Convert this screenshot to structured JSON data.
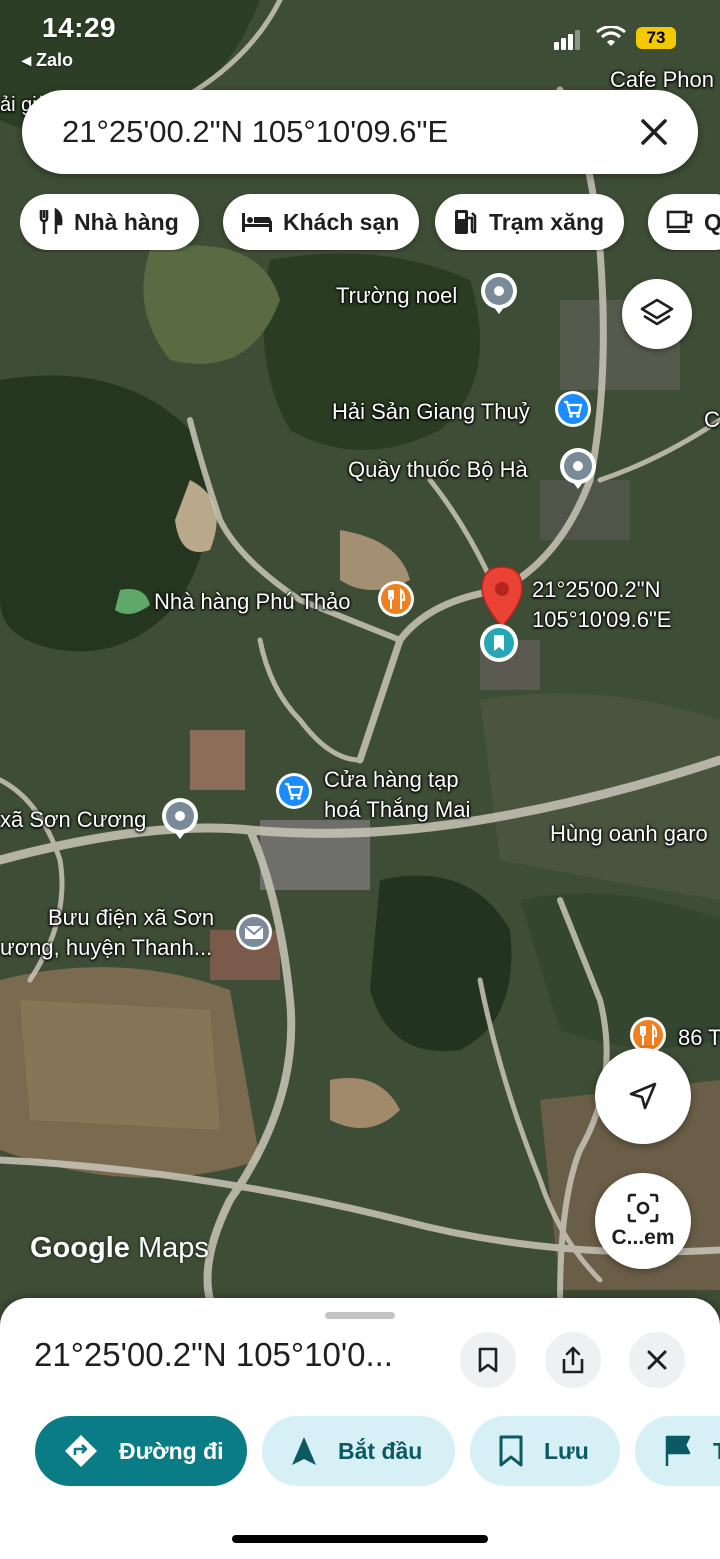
{
  "status_bar": {
    "time": "14:29",
    "back_app": "Zalo",
    "battery": "73"
  },
  "search": {
    "query": "21°25'00.2\"N 105°10'09.6\"E"
  },
  "chips": [
    {
      "label": "Nhà hàng",
      "icon": "restaurant-icon"
    },
    {
      "label": "Khách sạn",
      "icon": "hotel-icon"
    },
    {
      "label": "Trạm xăng",
      "icon": "gas-station-icon"
    },
    {
      "label": "Q",
      "icon": "coffee-icon"
    }
  ],
  "map": {
    "labels": {
      "cafe": "Cafe Phon",
      "top_left": "ải già",
      "truong_noel": "Trường noel",
      "hai_san": "Hải Sản Giang Thuỷ",
      "quay_thuoc": "Quầy thuốc Bộ Hà",
      "coord_line1": "21°25'00.2\"N",
      "coord_line2": "105°10'09.6\"E",
      "nha_hang": "Nhà hàng Phú Thảo",
      "cua_hang_line1": "Cửa hàng tạp",
      "cua_hang_line2": "hoá Thắng Mai",
      "xa_son_cuong": "xã Sơn Cương",
      "hung_oanh": "Hùng oanh garo",
      "buu_dien_line1": "Bưu điện xã Sơn",
      "buu_dien_line2": "ương, huyện Thanh...",
      "so86": "86 T",
      "edge_c": "C"
    },
    "logo_google": "Google",
    "logo_maps": "Maps"
  },
  "fabs": {
    "camera_label": "C...em"
  },
  "sheet": {
    "title": "21°25'00.2\"N 105°10'0...",
    "actions": [
      {
        "label": "Đường đi"
      },
      {
        "label": "Bắt đầu"
      },
      {
        "label": "Lưu"
      },
      {
        "label": "T"
      }
    ]
  }
}
